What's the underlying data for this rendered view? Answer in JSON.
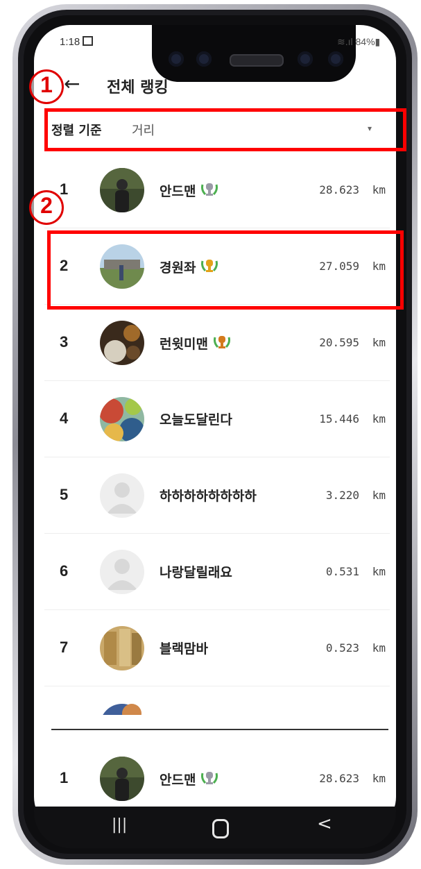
{
  "status_bar": {
    "time": "1:18",
    "battery": "84%"
  },
  "header": {
    "back_icon": "←",
    "title": "전체 랭킹"
  },
  "sort": {
    "label": "정렬 기준",
    "value": "거리",
    "caret": "▾"
  },
  "ranking": [
    {
      "rank": "1",
      "name": "안드맨",
      "distance": "28.623",
      "unit": "km",
      "trophy": "silver",
      "avatar": "person-dark"
    },
    {
      "rank": "2",
      "name": "경원좌",
      "distance": "27.059",
      "unit": "km",
      "trophy": "gold",
      "avatar": "landscape"
    },
    {
      "rank": "3",
      "name": "런윗미맨",
      "distance": "20.595",
      "unit": "km",
      "trophy": "bronze",
      "avatar": "food"
    },
    {
      "rank": "4",
      "name": "오늘도달린다",
      "distance": "15.446",
      "unit": "km",
      "trophy": "",
      "avatar": "abstract"
    },
    {
      "rank": "5",
      "name": "하하하하하하하하",
      "distance": "3.220",
      "unit": "km",
      "trophy": "",
      "avatar": "default"
    },
    {
      "rank": "6",
      "name": "나랑달릴래요",
      "distance": "0.531",
      "unit": "km",
      "trophy": "",
      "avatar": "default"
    },
    {
      "rank": "7",
      "name": "블랙맘바",
      "distance": "0.523",
      "unit": "km",
      "trophy": "",
      "avatar": "wood"
    }
  ],
  "my_rank": {
    "rank": "1",
    "name": "안드맨",
    "distance": "28.623",
    "unit": "km",
    "trophy": "silver"
  },
  "nav": {
    "recent": "|||",
    "home": "",
    "back": "<"
  },
  "annotations": {
    "one": "1",
    "two": "2"
  },
  "colors": {
    "annotation": "#ff0000",
    "gold": "#e3a21a",
    "silver": "#9a9aa6",
    "bronze": "#d47a1c",
    "laurel": "#4caf50"
  }
}
